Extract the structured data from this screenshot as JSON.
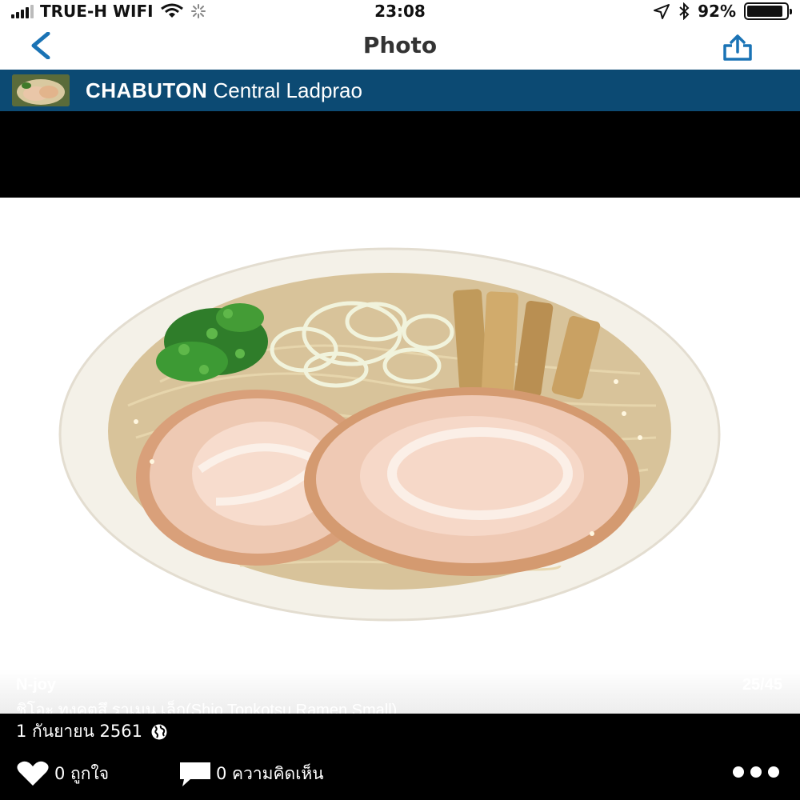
{
  "status_bar": {
    "carrier": "TRUE-H WIFI",
    "time": "23:08",
    "battery_percent": "92%",
    "battery_level": 0.92,
    "icons": [
      "signal-icon",
      "wifi-icon",
      "loading-icon",
      "location-arrow-icon",
      "bluetooth-icon",
      "battery-icon"
    ]
  },
  "nav": {
    "title": "Photo",
    "back_icon": "chevron-left-icon",
    "share_icon": "share-icon",
    "accent_color": "#1a73b5"
  },
  "place": {
    "name_bold": "CHABUTON",
    "name_rest": " Central Ladprao",
    "header_color": "#0c4a73"
  },
  "photo": {
    "uploader": "N-joy",
    "counter": "25/45",
    "caption": "ชิโอะ ทงคตสึ ราเมน  เล็ก(Shio Tonkotsu Ramen Small)"
  },
  "meta": {
    "date": "1 กันยายน 2561",
    "privacy_icon": "globe-icon"
  },
  "actions": {
    "likes": "0 ถูกใจ",
    "comments": "0 ความคิดเห็น",
    "more_icon": "more-dots-icon"
  }
}
